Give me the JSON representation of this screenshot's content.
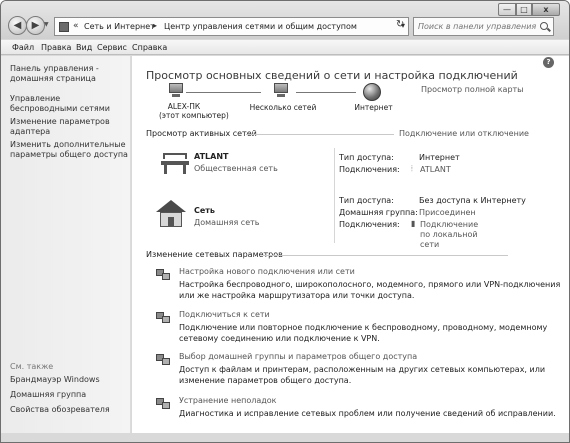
{
  "address": {
    "segment1": "Сеть и Интернет",
    "separator": "▸",
    "segment2": "Центр управления сетями и общим доступом"
  },
  "search": {
    "placeholder": "Поиск в панели управления"
  },
  "window_controls": {
    "minimize": "—",
    "maximize": "□",
    "close": "x"
  },
  "menu": [
    "Файл",
    "Правка",
    "Вид",
    "Сервис",
    "Справка"
  ],
  "sidebar": {
    "items": [
      "Панель управления - домашняя страница",
      "Управление беспроводными сетями",
      "Изменение параметров адаптера",
      "Изменить дополнительные параметры общего доступа"
    ],
    "see_also_title": "См. также",
    "see_also": [
      "Брандмауэр Windows",
      "Домашняя группа",
      "Свойства обозревателя"
    ]
  },
  "main": {
    "heading": "Просмотр основных сведений о сети и настройка подключений",
    "map": {
      "computer": "ALEX-ПК",
      "computer_sub": "(этот компьютер)",
      "networks": "Несколько сетей",
      "internet": "Интернет",
      "full_map_link": "Просмотр полной карты"
    },
    "active": {
      "title": "Просмотр активных сетей",
      "link": "Подключение или отключение",
      "networks": [
        {
          "name": "ATLANT",
          "type": "Общественная сеть",
          "access_label": "Тип доступа:",
          "access_value": "Интернет",
          "connections_label": "Подключения:",
          "connections_value": "ATLANT"
        },
        {
          "name": "Сеть",
          "type": "Домашняя сеть",
          "access_label": "Тип доступа:",
          "access_value": "Без доступа к Интернету",
          "homegroup_label": "Домашняя группа:",
          "homegroup_value": "Присоединен",
          "connections_label": "Подключения:",
          "connections_value": "Подключение по локальной сети"
        }
      ]
    },
    "change": {
      "title": "Изменение сетевых параметров",
      "tasks": [
        {
          "title": "Настройка нового подключения или сети",
          "desc1": "Настройка беспроводного, широкополосного, модемного, прямого или VPN-подключения",
          "desc2": "или же настройка маршрутизатора или точки доступа."
        },
        {
          "title": "Подключиться к сети",
          "desc1": "Подключение или повторное подключение к беспроводному, проводному, модемному",
          "desc2": "сетевому соединению или подключение к VPN."
        },
        {
          "title": "Выбор домашней группы и параметров общего доступа",
          "desc1": "Доступ к файлам и принтерам, расположенным на других сетевых компьютерах, или",
          "desc2": "изменение параметров общего доступа."
        },
        {
          "title": "Устранение неполадок",
          "desc1": "Диагностика и исправление сетевых проблем или получение сведений об исправлении."
        }
      ]
    }
  }
}
